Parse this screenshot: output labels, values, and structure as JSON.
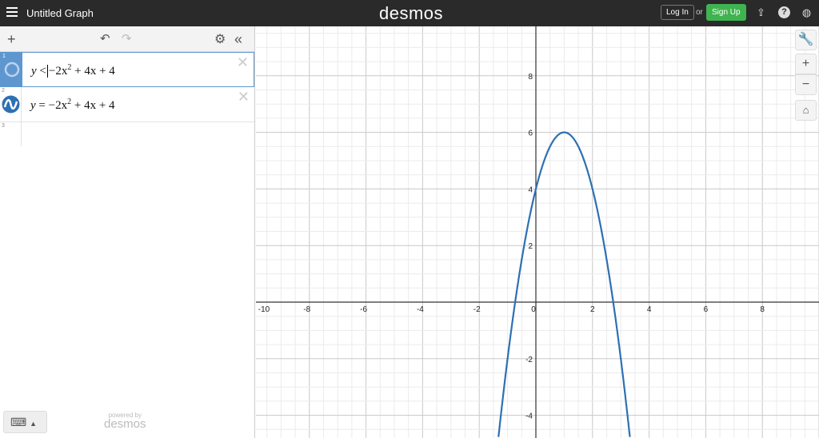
{
  "header": {
    "title": "Untitled Graph",
    "logo": "desmos",
    "login": "Log In",
    "or": "or",
    "signup": "Sign Up",
    "icons": [
      "share-icon",
      "help-icon",
      "globe-icon"
    ]
  },
  "expressions": [
    {
      "num": "1",
      "lhs": "y",
      "op": "<",
      "coef": "−2x",
      "exp": "2",
      "rest": " + 4x + 4",
      "icon": "circle-icon"
    },
    {
      "num": "2",
      "lhs": "y",
      "op": "=",
      "coef": "−2x",
      "exp": "2",
      "rest": " + 4x + 4",
      "icon": "wave-icon"
    },
    {
      "num": "3"
    }
  ],
  "footer": {
    "powered_by": "powered by",
    "brand": "desmos"
  },
  "colors": {
    "curve": "#2d70b3",
    "accent": "#5e97d0",
    "signup": "#3fb34f"
  },
  "graph": {
    "xticks": [
      -10,
      -8,
      -6,
      -4,
      -2,
      0,
      2,
      4,
      6,
      8
    ],
    "yticks": [
      8,
      6,
      4,
      2,
      -2,
      -4
    ],
    "curve": {
      "a": -2,
      "b": 4,
      "c": 4
    }
  }
}
